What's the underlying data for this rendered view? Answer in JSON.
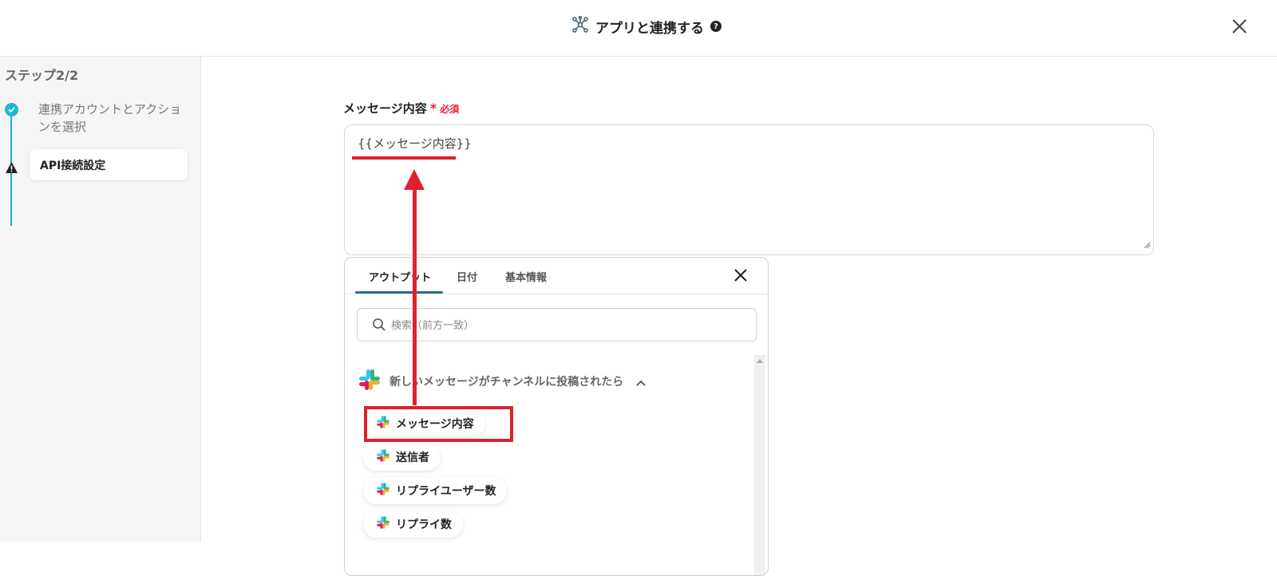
{
  "header": {
    "title": "アプリと連携する",
    "help_icon": "?"
  },
  "sidebar": {
    "step_label": "ステップ2/2",
    "steps": [
      {
        "label": "連携アカウントとアクションを選択",
        "status": "completed"
      },
      {
        "label": "API接続設定",
        "status": "warning"
      }
    ]
  },
  "main": {
    "field_label": "メッセージ内容",
    "required_mark": "*",
    "required_text": "必須",
    "field_value": "{{メッセージ内容}}"
  },
  "popup": {
    "tabs": [
      {
        "label": "アウトプット"
      },
      {
        "label": "日付"
      },
      {
        "label": "基本情報"
      }
    ],
    "search_placeholder": "検索（前方一致）",
    "group_title": "新しいメッセージがチャンネルに投稿されたら",
    "items": [
      {
        "label": "メッセージ内容"
      },
      {
        "label": "送信者"
      },
      {
        "label": "リプライユーザー数"
      },
      {
        "label": "リプライ数"
      }
    ]
  },
  "colors": {
    "accent": "#1fb7cf",
    "annotation_red": "#e0202a",
    "required_red": "#e0263a",
    "tab_underline": "#2a6d8a"
  }
}
